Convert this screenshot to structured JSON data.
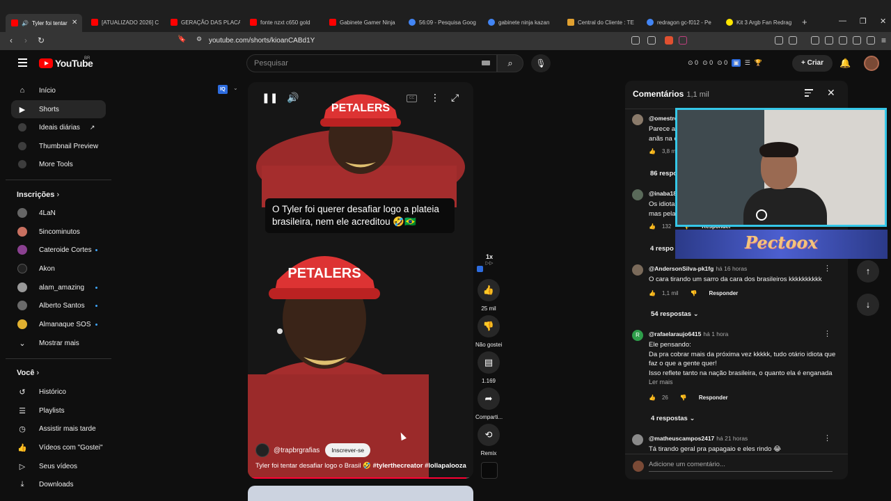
{
  "browser": {
    "tabs": [
      {
        "label": "Tyler foi tentar",
        "color": "#ff0000",
        "active": true
      },
      {
        "label": "[ATUALIZADO 2026] C",
        "color": "#ff0000"
      },
      {
        "label": "GERAÇÃO DAS PLACA",
        "color": "#ff0000"
      },
      {
        "label": "fonte nzxt c650 gold",
        "color": "#ff0000"
      },
      {
        "label": "Gabinete Gamer Ninja",
        "color": "#ff0000"
      },
      {
        "label": "56:09 - Pesquisa Goog",
        "color": "#4285f4"
      },
      {
        "label": "gabinete ninja kazan",
        "color": "#4285f4"
      },
      {
        "label": "Central do Cliente : TE",
        "color": "#e0a030"
      },
      {
        "label": "redragon gc-f012 - Pe",
        "color": "#4285f4"
      },
      {
        "label": "Kit 3 Argb Fan Redrag",
        "color": "#ffe600"
      }
    ],
    "url": "youtube.com/shorts/kioanCABd1Y"
  },
  "header": {
    "logo_text": "YouTube",
    "logo_country": "BR",
    "search_placeholder": "Pesquisar",
    "stats": [
      "0",
      "0",
      "0"
    ],
    "create_label": "Criar"
  },
  "sidebar": {
    "main": [
      {
        "label": "Início",
        "icon": "home-icon"
      },
      {
        "label": "Shorts",
        "icon": "shorts-icon",
        "active": true
      },
      {
        "label": "Ideais diárias",
        "icon": "extension-icon",
        "external": true
      },
      {
        "label": "Thumbnail Preview",
        "icon": "extension-icon"
      },
      {
        "label": "More Tools",
        "icon": "extension-icon"
      }
    ],
    "subscriptions_title": "Inscrições",
    "subscriptions": [
      {
        "label": "4LaN",
        "color": "#666666",
        "live": false
      },
      {
        "label": "5incominutos",
        "color": "#c87060",
        "live": false
      },
      {
        "label": "Cateroide Cortes",
        "color": "#8a4090",
        "live": true
      },
      {
        "label": "Akon",
        "color": "#222222",
        "live": false
      },
      {
        "label": "alam_amazing",
        "color": "#999999",
        "live": true
      },
      {
        "label": "Alberto Santos",
        "color": "#6a6a6a",
        "live": true
      },
      {
        "label": "Almanaque SOS",
        "color": "#e0b030",
        "live": true
      }
    ],
    "show_more": "Mostrar mais",
    "you_title": "Você",
    "you": [
      {
        "label": "Histórico",
        "icon": "history-icon"
      },
      {
        "label": "Playlists",
        "icon": "playlist-icon"
      },
      {
        "label": "Assistir mais tarde",
        "icon": "clock-icon"
      },
      {
        "label": "Vídeos com \"Gostei\"",
        "icon": "like-icon"
      },
      {
        "label": "Seus vídeos",
        "icon": "video-icon"
      },
      {
        "label": "Downloads",
        "icon": "download-icon"
      }
    ]
  },
  "video": {
    "caption": "O Tyler foi querer desafiar logo a plateia brasileira, nem ele acreditou 🤣🇧🇷",
    "channel": "@trapbrgrafias",
    "subscribe": "Inscrever-se",
    "title": "Tyler foi tentar desafiar logo o Brasil 🤣",
    "hashtags": "#tylerthecreator #lollapalooza",
    "progress": 0.97,
    "hat_text": "PETALERS"
  },
  "actions": {
    "speed": "1x",
    "likes": "25 mil",
    "dislike": "Não gostei",
    "comments": "1.169",
    "share": "Comparti...",
    "remix": "Remix"
  },
  "comments": {
    "title": "Comentários",
    "count": "1,1 mil",
    "items": [
      {
        "user": "@omestre",
        "time": "",
        "text": "Parece a\nanãs na e",
        "likes": "3,8 mil",
        "replies": "86 respo",
        "avatar": "#8a7a6a"
      },
      {
        "user": "@inaba18",
        "time": "",
        "text": "Os idiota\nmas pela",
        "likes": "132",
        "replies": "4 respo",
        "avatar": "#5a6a5a"
      },
      {
        "user": "@AndersonSilva-pk1fg",
        "time": "há 16 horas",
        "text": "O cara tirando um sarro da cara dos brasileiros kkkkkkkkkk",
        "likes": "1,1 mil",
        "replies": "54 respostas",
        "avatar": "#7a6a5a"
      },
      {
        "user": "@rafaelaraujo6415",
        "time": "há 1 hora",
        "text": "Ele pensando:\nDa pra cobrar mais da próxima vez kkkkk, tudo otário idiota que faz o que a gente quer!\nIsso reflete tanto na nação brasileira, o quanto ela é enganada ..",
        "likes": "26",
        "replies": "4 respostas",
        "read_more": "Ler mais",
        "avatar": "#2e9e4a",
        "initial": "R"
      },
      {
        "user": "@matheuscampos2417",
        "time": "há 21 horas",
        "text": "Tá tirando geral pra papagaio e eles rindo 😂",
        "avatar": "#8a8a8a"
      }
    ],
    "reply_label": "Responder",
    "add_placeholder": "Adicione um comentário..."
  },
  "overlay": {
    "brand": "Pectoox"
  }
}
